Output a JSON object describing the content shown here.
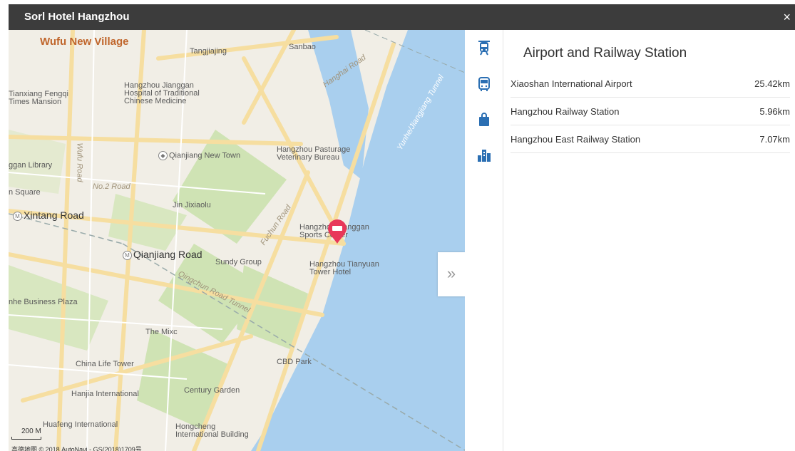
{
  "window": {
    "title": "Sorl Hotel Hangzhou",
    "close_glyph": "×"
  },
  "map": {
    "labels": {
      "wufu_new_village": "Wufu New Village",
      "tangjiajing": "Tangjiajing",
      "sanbao": "Sanbao",
      "hanghai_road": "Hanghai Road",
      "hospital": "Hangzhou Jianggan\nHospital of Traditional\nChinese Medicine",
      "tianxiang": "Tianxiang Fengqi\nTimes Mansion",
      "yunhe_tunnel": "Yunhe/Jiangjiang Tunnel",
      "qianjiang_new_town": "Qianjiang New Town",
      "pasturage": "Hangzhou Pasturage\nVeterinary Bureau",
      "library": "ggan Library",
      "wufu_road": "Wufu Road",
      "no2_road": "No.2 Road",
      "square": "n Square",
      "jin_jixiaolu": "Jin Jixiaolu",
      "xintang_road": "Xintang Road",
      "fuchun_road": "Fuchun Road",
      "sports_center": "Hangzhou Jianggan\nSports Center",
      "qianjiang_road": "Qianjiang Road",
      "sundy_group": "Sundy Group",
      "tianyuan": "Hangzhou Tianyuan\nTower Hotel",
      "business_plaza": "nhe Business Plaza",
      "qingchun_tunnel": "Qingchun Road Tunnel",
      "the_mixc": "The Mixc",
      "cbd_park": "CBD Park",
      "china_life": "China Life Tower",
      "hanjia": "Hanjia International",
      "century_garden": "Century Garden",
      "huafeng": "Huafeng International",
      "hongcheng": "Hongcheng\nInternational Building"
    },
    "scale": "200 M",
    "copyright": "高德地图 © 2018 AutoNavi - GS(2018)1709号",
    "expand_glyph": "»"
  },
  "categories": [
    {
      "name": "transport",
      "icon": "train-icon",
      "active": true
    },
    {
      "name": "bus",
      "icon": "bus-icon",
      "active": false
    },
    {
      "name": "shopping",
      "icon": "shopping-bag-icon",
      "active": false
    },
    {
      "name": "landmark",
      "icon": "building-icon",
      "active": false
    }
  ],
  "panel": {
    "title": "Airport and Railway Station",
    "rows": [
      {
        "name": "Xiaoshan International Airport",
        "distance": "25.42km"
      },
      {
        "name": "Hangzhou Railway Station",
        "distance": "5.96km"
      },
      {
        "name": "Hangzhou East Railway Station",
        "distance": "7.07km"
      }
    ]
  },
  "colors": {
    "titlebar": "#3c3c3c",
    "water": "#a9cfee",
    "green": "#cfe3b4",
    "road": "#f6dea0",
    "marker": "#e8375a",
    "icon_active": "#2b6fb3"
  }
}
